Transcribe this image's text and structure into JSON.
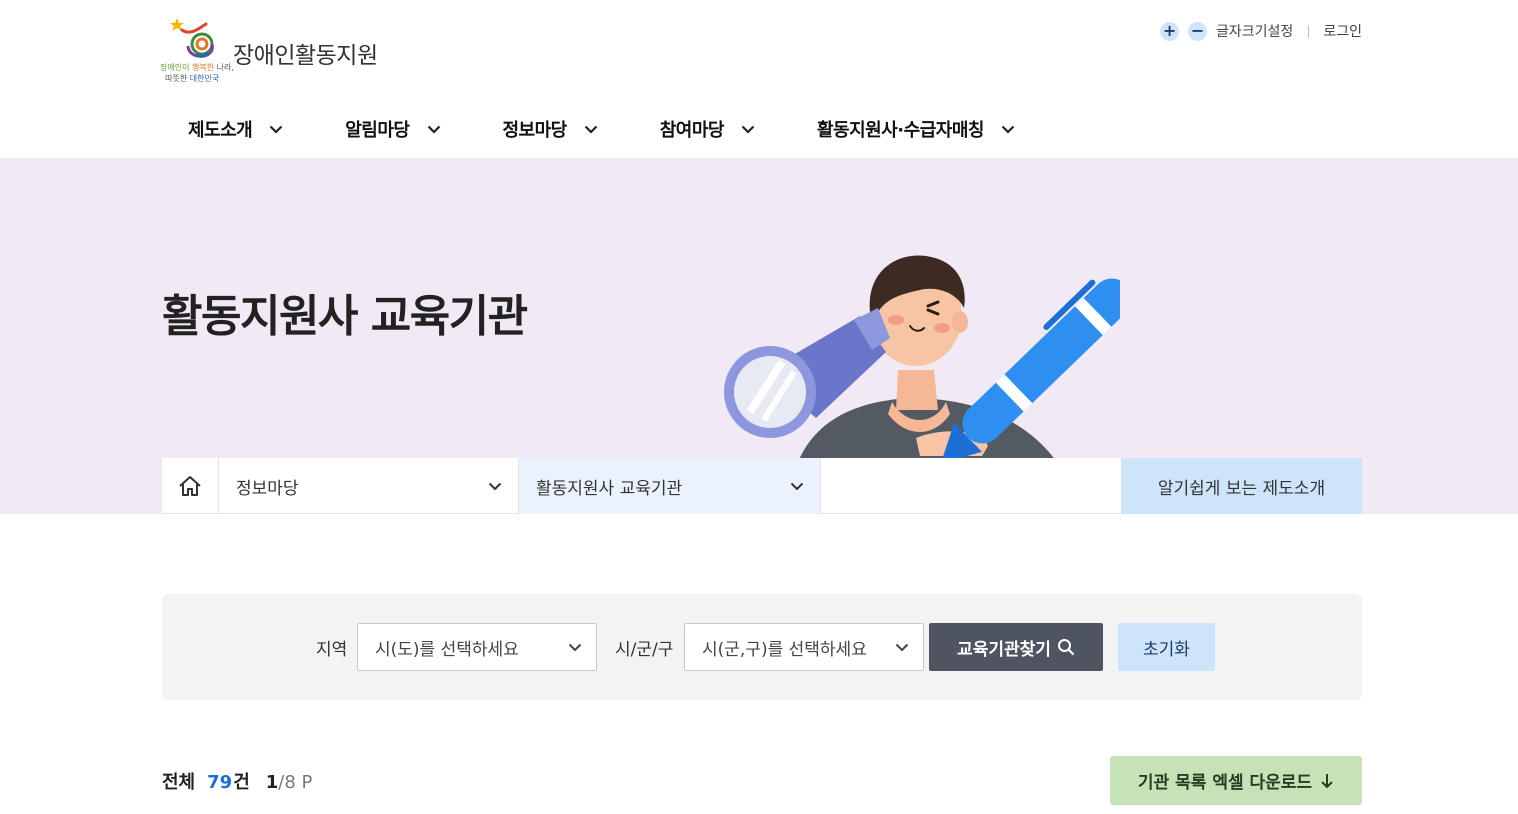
{
  "brand": {
    "name": "장애인활동지원",
    "slogan_part1": "장애인이",
    "slogan_part2": "행복한",
    "slogan_part3": "나라,",
    "slogan_part4": "따뜻한",
    "slogan_part5": "대한민국"
  },
  "util": {
    "zoom_in": "+",
    "zoom_out": "−",
    "font_setting": "글자크기설정",
    "separator": "|",
    "login": "로그인"
  },
  "gnb": [
    {
      "label": "제도소개"
    },
    {
      "label": "알림마당"
    },
    {
      "label": "정보마당"
    },
    {
      "label": "참여마당"
    },
    {
      "label": "활동지원사·수급자매칭"
    }
  ],
  "hero": {
    "title": "활동지원사 교육기관"
  },
  "breadcrumb": {
    "level1": "정보마당",
    "level2": "활동지원사 교육기관",
    "guide": "알기쉽게 보는 제도소개"
  },
  "search": {
    "region_label": "지역",
    "region_placeholder": "시(도)를 선택하세요",
    "district_label": "시/군/구",
    "district_placeholder": "시(군,구)를 선택하세요",
    "find_button": "교육기관찾기",
    "reset_button": "초기화"
  },
  "result": {
    "total_label": "전체",
    "count": "79",
    "unit": "건",
    "page_current": "1",
    "page_total": "/8 P",
    "excel_button": "기관 목록 엑셀 다운로드"
  },
  "colors": {
    "hero_bg": "#f1eaf5",
    "accent_blue": "#1d6fd6",
    "find_button_bg": "#4f5560",
    "light_blue": "#cde4fb",
    "excel_green": "#c6e3b8"
  },
  "icons": [
    "logo-mark",
    "zoom-in-icon",
    "zoom-out-icon",
    "chevron-down-icon",
    "home-icon",
    "search-icon",
    "download-arrow-icon"
  ]
}
